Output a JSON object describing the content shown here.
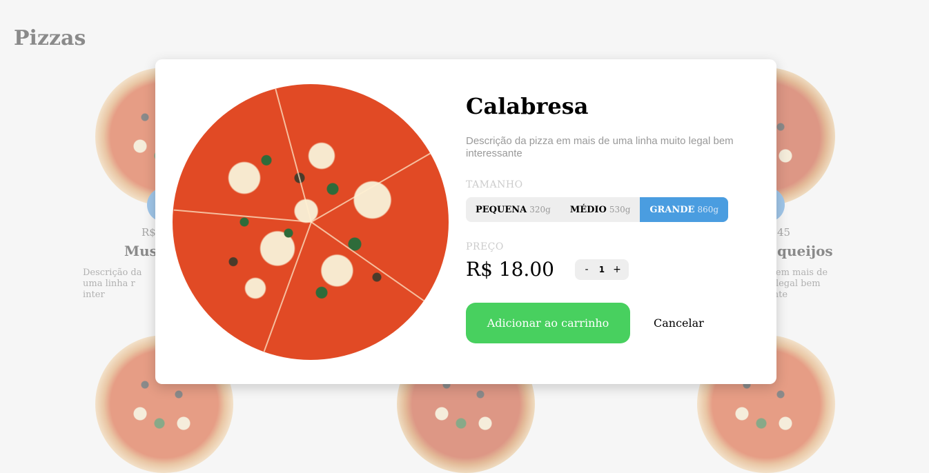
{
  "page": {
    "title": "Pizzas"
  },
  "background_cards": [
    {
      "price": "R$",
      "name": "Mus",
      "desc": "Descrição da | uma linha r | inter"
    },
    {
      "price": "45",
      "name": "queijos",
      "desc": "a em mais de | o legal bem | ante"
    }
  ],
  "modal": {
    "name": "Calabresa",
    "description": "Descrição da pizza em mais de uma linha muito legal bem interessante",
    "size_label": "TAMANHO",
    "sizes": [
      {
        "name": "PEQUENA",
        "weight": "320g",
        "selected": false
      },
      {
        "name": "MÉDIO",
        "weight": "530g",
        "selected": false
      },
      {
        "name": "GRANDE",
        "weight": "860g",
        "selected": true
      }
    ],
    "price_label": "PREÇO",
    "price": "R$ 18.00",
    "quantity": {
      "minus": "-",
      "value": "1",
      "plus": "+"
    },
    "add_button": "Adicionar ao carrinho",
    "cancel_button": "Cancelar"
  },
  "colors": {
    "accent_blue": "#4a9de0",
    "add_green": "#48d05f",
    "background": "#f6f6f6"
  }
}
